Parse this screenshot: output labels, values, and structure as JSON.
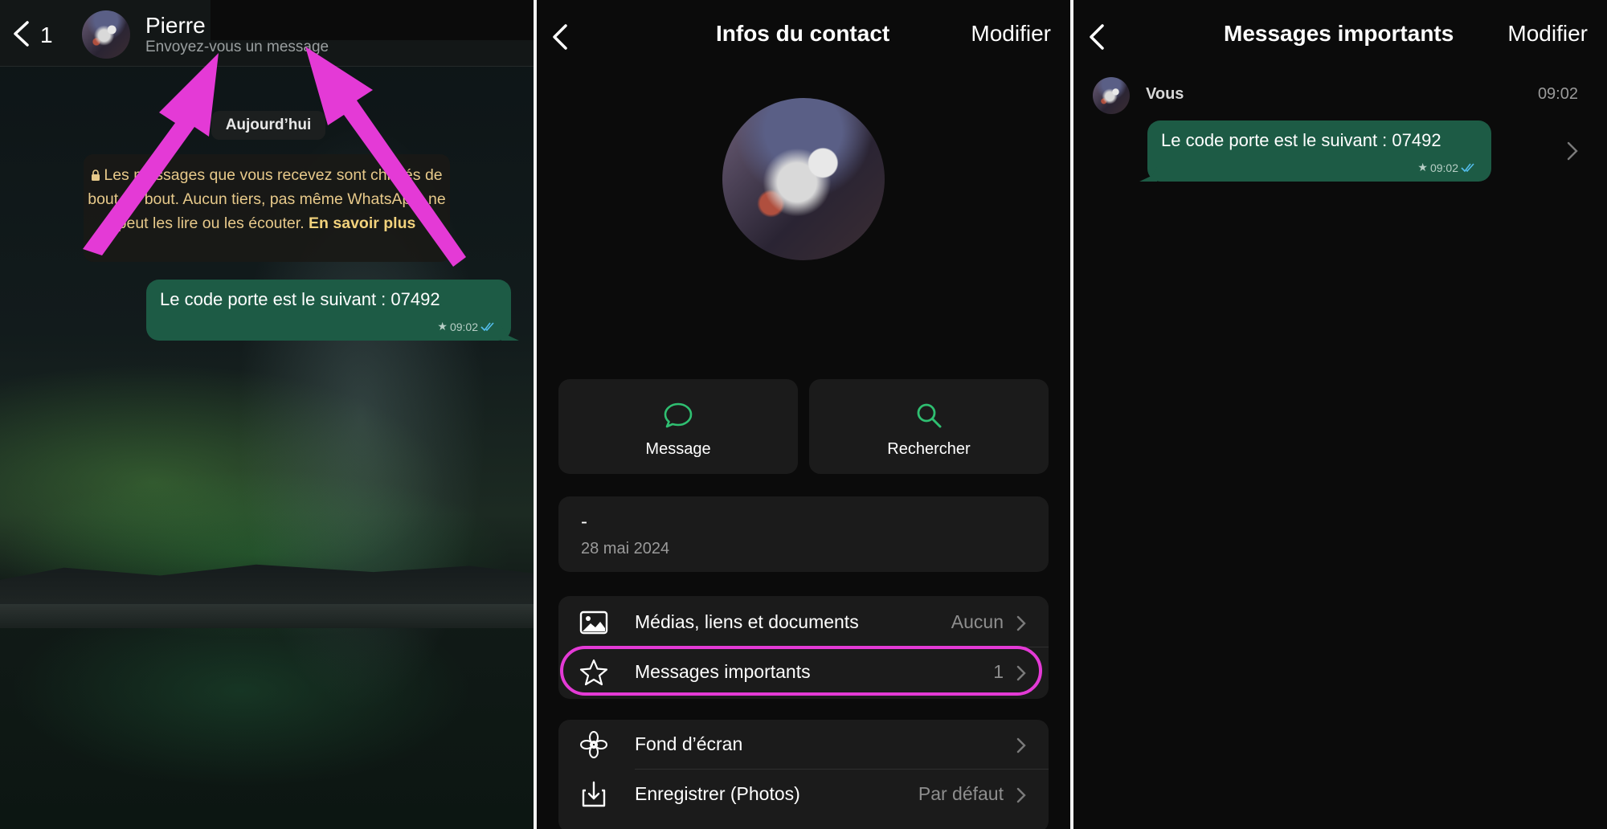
{
  "chat": {
    "back_count": "1",
    "contact_name": "Pierre",
    "contact_status": "Envoyez-vous un message",
    "date_chip": "Aujourd’hui",
    "notice_text": "Les messages que vous recevez sont chiffrés de bout en bout. Aucun tiers, pas même WhatsApp, ne peut les lire ou les écouter.",
    "notice_link": "En savoir plus",
    "message": {
      "text": "Le code porte est le suivant : 07492",
      "time": "09:02",
      "starred": "★"
    }
  },
  "contact_info": {
    "title": "Infos du contact",
    "edit": "Modifier",
    "actions": [
      {
        "label": "Message",
        "icon": "message-icon"
      },
      {
        "label": "Rechercher",
        "icon": "search-icon"
      }
    ],
    "about": {
      "text": "-",
      "date": "28 mai 2024"
    },
    "rows": [
      {
        "label": "Médias, liens et documents",
        "value": "Aucun",
        "icon": "image-icon"
      },
      {
        "label": "Messages importants",
        "value": "1",
        "icon": "star-icon"
      },
      {
        "label": "Fond d’écran",
        "value": "",
        "icon": "flower-icon"
      },
      {
        "label": "Enregistrer (Photos)",
        "value": "Par défaut",
        "icon": "save-icon"
      }
    ]
  },
  "starred": {
    "title": "Messages importants",
    "edit": "Modifier",
    "from": "Vous",
    "time": "09:02",
    "message": {
      "text": "Le code porte est le suivant : 07492",
      "time": "09:02",
      "starred": "★"
    }
  },
  "colors": {
    "bubble": "#1d5b45",
    "accent_green": "#2fbf71",
    "annotation_magenta": "#e43ad6",
    "notice_text": "#e7c98a"
  }
}
